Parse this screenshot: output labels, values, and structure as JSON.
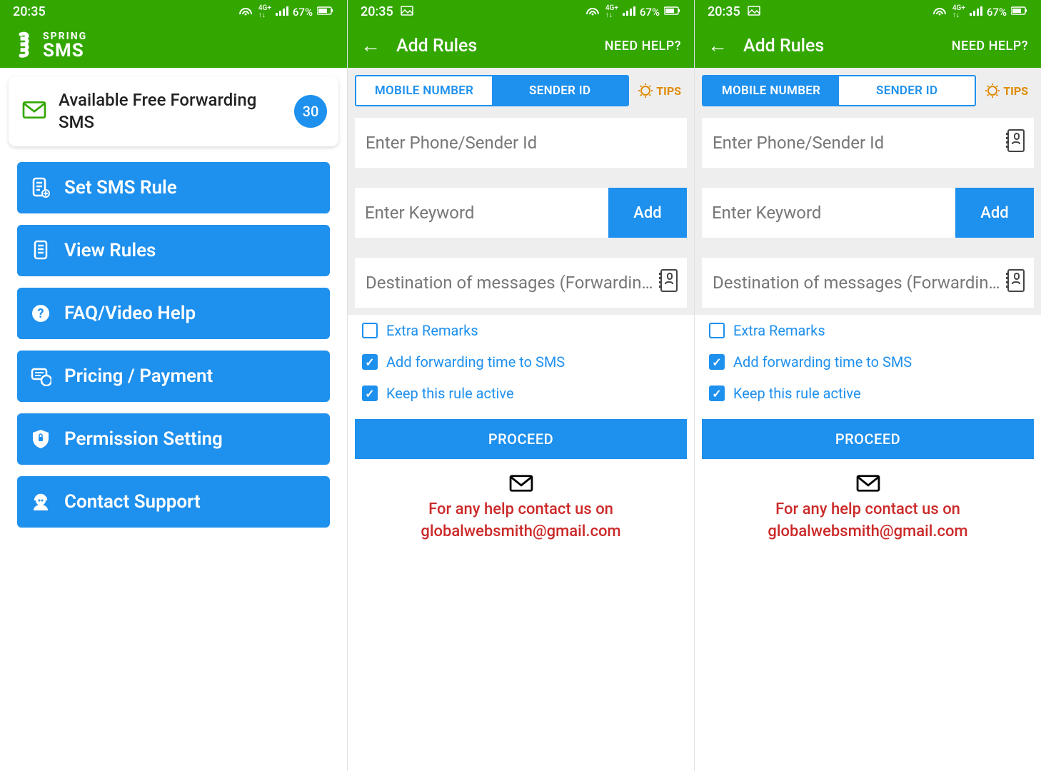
{
  "status": {
    "time": "20:35",
    "battery": "67%"
  },
  "app": {
    "brand_top": "SPRING",
    "brand_main": "SMS"
  },
  "home": {
    "card_title": "Available Free Forwarding SMS",
    "card_badge": "30",
    "buttons": {
      "set_rule": "Set SMS Rule",
      "view_rules": "View Rules",
      "faq": "FAQ/Video Help",
      "pricing": "Pricing / Payment",
      "permission": "Permission Setting",
      "contact": "Contact Support"
    }
  },
  "rules": {
    "title": "Add Rules",
    "help": "NEED HELP?",
    "tab_mobile": "MOBILE NUMBER",
    "tab_sender": "SENDER ID",
    "tips": "TIPS",
    "ph_phone": "Enter Phone/Sender Id",
    "ph_keyword": "Enter Keyword",
    "add": "Add",
    "ph_dest": "Destination of messages (Forwardin…",
    "chk_remarks": "Extra Remarks",
    "chk_time": "Add forwarding time to SMS",
    "chk_active": "Keep this rule active",
    "proceed": "PROCEED",
    "help_line1": "For any help contact us on",
    "help_line2": "globalwebsmith@gmail.com"
  }
}
